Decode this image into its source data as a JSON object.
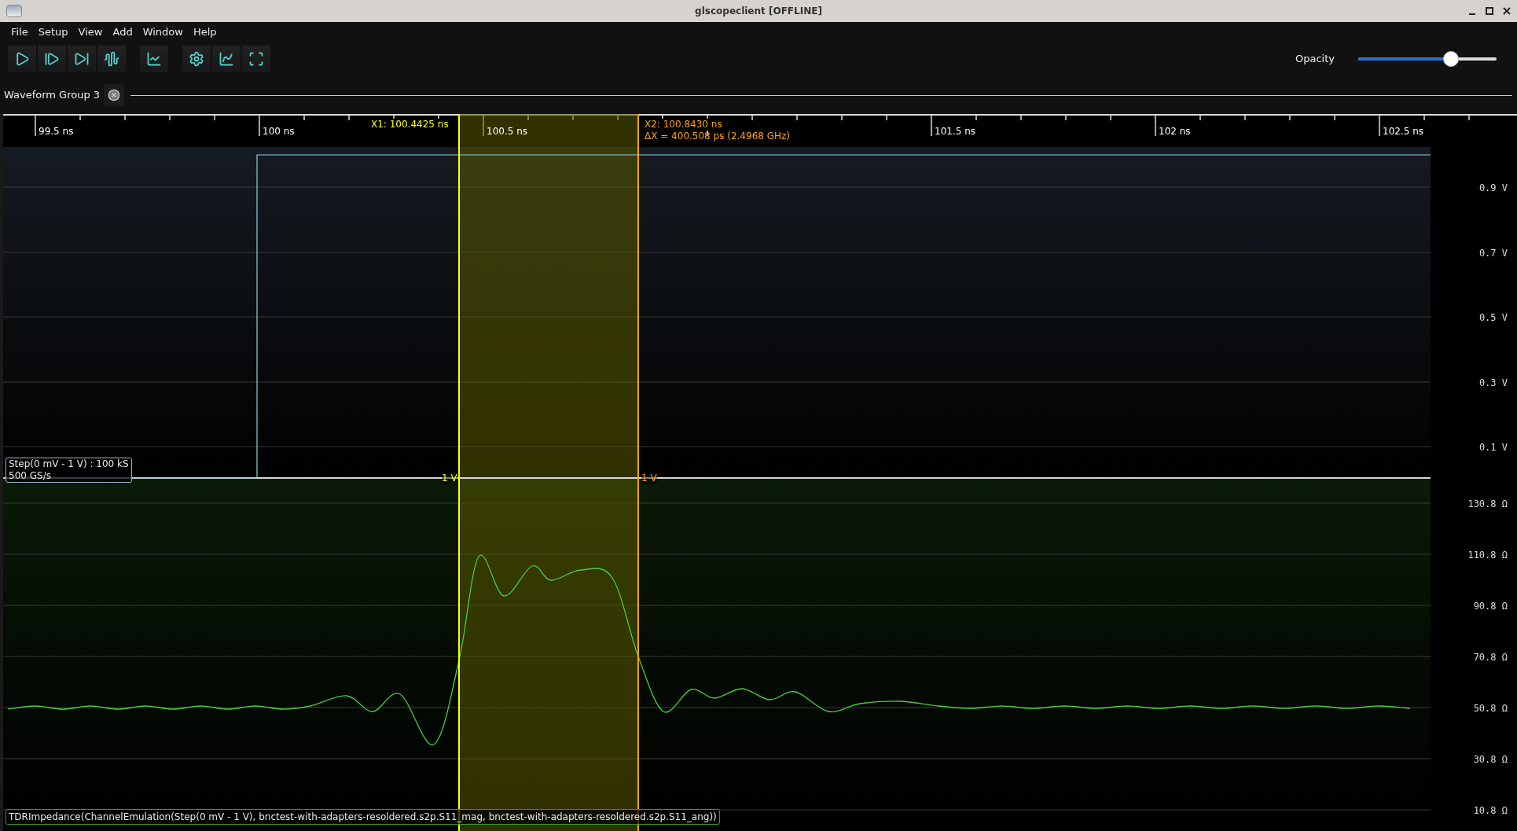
{
  "window": {
    "title": "glscopeclient [OFFLINE]"
  },
  "menu": [
    "File",
    "Setup",
    "View",
    "Add",
    "Window",
    "Help"
  ],
  "opacity": {
    "label": "Opacity",
    "level": 0.67
  },
  "tabs": [
    {
      "label": "Waveform Group 3",
      "selected": true
    }
  ],
  "timeline": {
    "ticks": [
      "99.5 ns",
      "100 ns",
      "100.5 ns",
      "101.5 ns",
      "102 ns",
      "102.5 ns"
    ]
  },
  "cursors": [
    {
      "label": "X1: 100.4425 ns",
      "level_label": "1 V",
      "color": "#ffff00"
    },
    {
      "label": "X2: 100.8430 ns",
      "delta": "ΔX = 400.508 ps (2.4968 GHz)",
      "level_label": "1 V",
      "color": "#ffa500"
    }
  ],
  "channels": [
    {
      "kind": "step",
      "label_lines": [
        "Step(0 mV - 1 V) : 100 kS",
        "500 GS/s"
      ],
      "axis": [
        "0.9 V",
        "0.7 V",
        "0.5 V",
        "0.3 V",
        "0.1 V"
      ]
    },
    {
      "kind": "tdr",
      "label_lines": [
        "TDRImpedance(ChannelEmulation(Step(0 mV - 1 V), bnctest-with-adapters-resoldered.s2p.S11_mag, bnctest-with-adapters-resoldered.s2p.S11_ang))"
      ],
      "axis": [
        "130.8 Ω",
        "110.8 Ω",
        "90.8 Ω",
        "70.8 Ω",
        "50.8 Ω",
        "30.8 Ω",
        "10.8 Ω"
      ]
    }
  ]
}
